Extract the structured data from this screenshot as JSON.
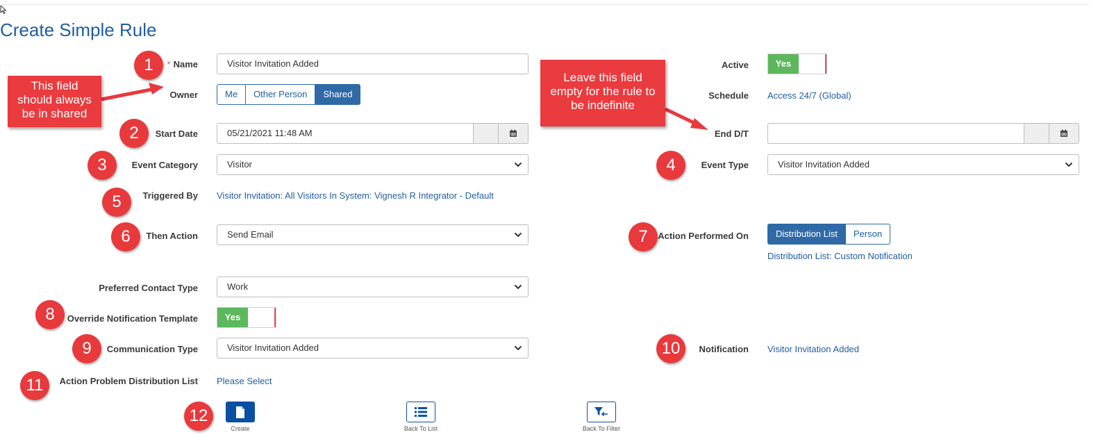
{
  "page_title": "Create Simple Rule",
  "form": {
    "name": {
      "label": "Name",
      "required_mark": "*",
      "value": "Visitor Invitation Added"
    },
    "owner": {
      "label": "Owner",
      "options": [
        "Me",
        "Other Person",
        "Shared"
      ],
      "selected": "Shared"
    },
    "start_date": {
      "label": "Start Date",
      "value": "05/21/2021 11:48 AM"
    },
    "event_category": {
      "label": "Event Category",
      "value": "Visitor"
    },
    "triggered_by": {
      "label": "Triggered By",
      "value": "Visitor Invitation: All Visitors In System: Vignesh R Integrator - Default"
    },
    "then_action": {
      "label": "Then Action",
      "value": "Send Email"
    },
    "preferred_contact_type": {
      "label": "Preferred Contact Type",
      "value": "Work"
    },
    "override_notification_template": {
      "label": "Override Notification Template",
      "toggle": "Yes"
    },
    "communication_type": {
      "label": "Communication Type",
      "value": "Visitor Invitation Added"
    },
    "action_problem_distribution_list": {
      "label": "Action Problem Distribution List",
      "value": "Please Select"
    },
    "active": {
      "label": "Active",
      "toggle": "Yes"
    },
    "schedule": {
      "label": "Schedule",
      "value": "Access 24/7 (Global)"
    },
    "end_dt": {
      "label": "End D/T",
      "value": ""
    },
    "event_type": {
      "label": "Event Type",
      "value": "Visitor Invitation Added"
    },
    "action_performed_on": {
      "label": "Action Performed On",
      "options": [
        "Distribution List",
        "Person"
      ],
      "selected": "Distribution List",
      "detail": "Distribution List: Custom Notification"
    },
    "notification": {
      "label": "Notification",
      "value": "Visitor Invitation Added"
    }
  },
  "footer_buttons": {
    "create": "Create",
    "back_to_list": "Back To List",
    "back_to_filter": "Back To Filter"
  },
  "annotations": {
    "markers": [
      "1",
      "2",
      "3",
      "4",
      "5",
      "6",
      "7",
      "8",
      "9",
      "10",
      "11",
      "12"
    ],
    "callout_owner": [
      "This field",
      "should always",
      "be in shared"
    ],
    "callout_end": [
      "Leave this field",
      "empty for the rule to",
      "be indefinite"
    ]
  },
  "colors": {
    "link": "#1f5ea0",
    "toggle_on": "#5cb85c",
    "selected_button": "#2f6aa7",
    "annotation_red": "#e8393d"
  },
  "icons": {
    "date_picker": "calendar-icon",
    "select": "chevron-down-icon",
    "create": "document-icon",
    "back_to_list": "list-icon",
    "back_to_filter": "filter-back-icon"
  }
}
